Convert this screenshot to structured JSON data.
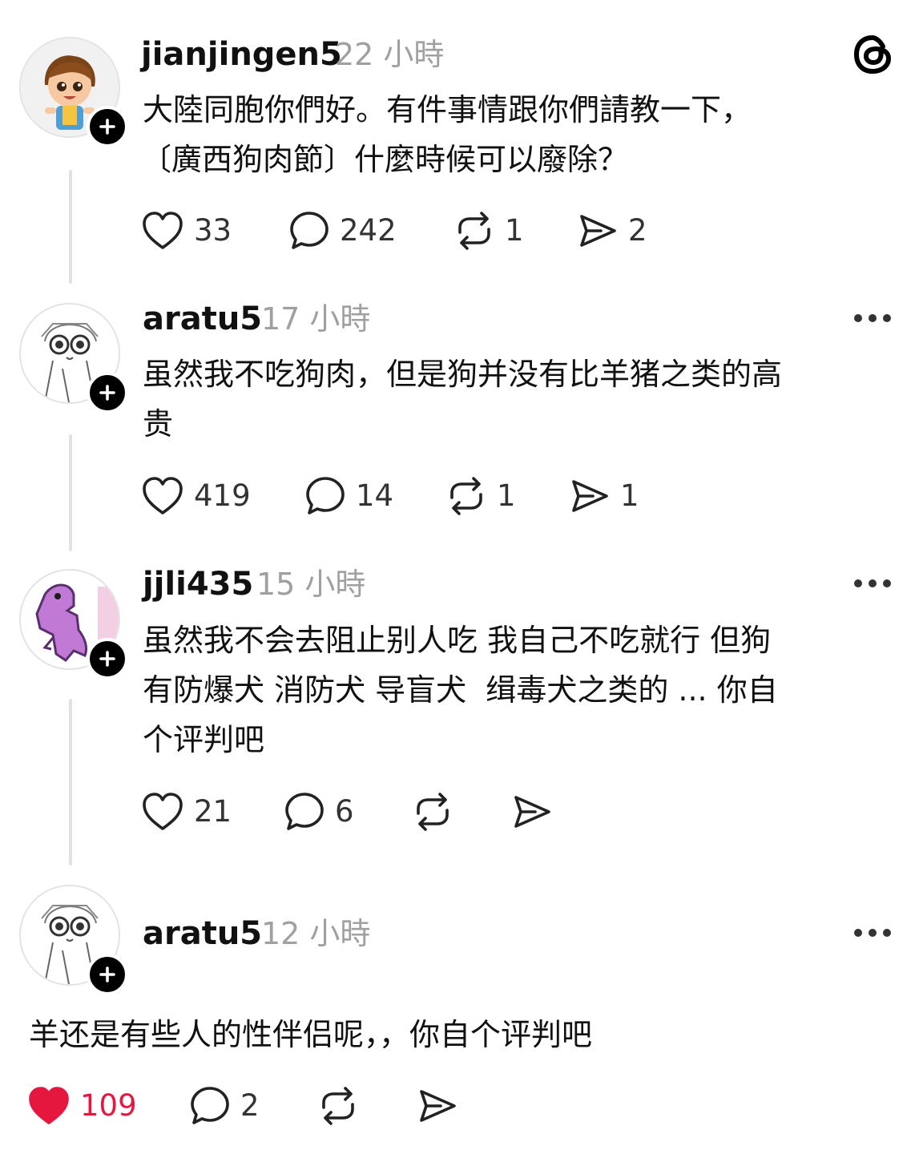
{
  "app": {
    "name": "Threads"
  },
  "posts": [
    {
      "username": "jianjingen5",
      "time": "22 小時",
      "text_lines": [
        "大陸同胞你們好。有件事情跟你們請教一下，",
        "〔廣西狗肉節〕什麼時候可以廢除？"
      ],
      "likes": "33",
      "replies": "242",
      "reposts": "1",
      "shares": "2",
      "liked": false
    },
    {
      "username": "aratu5",
      "time": "17 小時",
      "text_lines": [
        "虽然我不吃狗肉，但是狗并没有比羊猪之类的高",
        "贵"
      ],
      "likes": "419",
      "replies": "14",
      "reposts": "1",
      "shares": "1",
      "liked": false
    },
    {
      "username": "jjli435",
      "time": "15 小時",
      "text_lines": [
        "虽然我不会去阻止别人吃 我自己不吃就行 但狗",
        "有防爆犬 消防犬 导盲犬  缉毒犬之类的 ... 你自",
        "个评判吧"
      ],
      "likes": "21",
      "replies": "6",
      "reposts": "",
      "shares": "",
      "liked": false
    },
    {
      "username": "aratu5",
      "time": "12 小時",
      "text_lines": [
        "羊还是有些人的性伴侣呢，，你自个评判吧"
      ],
      "likes": "109",
      "replies": "2",
      "reposts": "",
      "shares": "",
      "liked": true
    }
  ],
  "colors": {
    "like_active": "#e5173f",
    "muted": "#a0a0a0",
    "thread_line": "#e2e2e2"
  },
  "icons": [
    "threads-logo-icon",
    "heart-icon",
    "comment-icon",
    "repost-icon",
    "share-icon",
    "more-icon",
    "plus-icon"
  ]
}
